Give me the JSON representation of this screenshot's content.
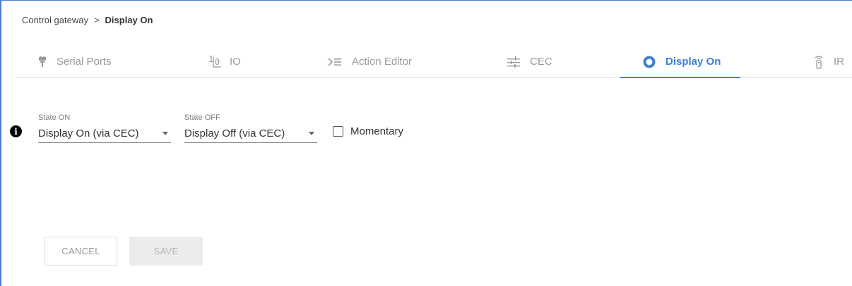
{
  "breadcrumb": {
    "parent": "Control gateway",
    "separator": ">",
    "current": "Display On"
  },
  "tabs": [
    {
      "label": "Serial Ports",
      "icon": "serial-port-icon"
    },
    {
      "label": "IO",
      "icon": "io-icon",
      "icon_text_top": "1",
      "icon_text_bottom": "0"
    },
    {
      "label": "Action Editor",
      "icon": "action-editor-icon"
    },
    {
      "label": "CEC",
      "icon": "cec-sliders-icon"
    },
    {
      "label": "Display On",
      "icon": "display-on-circle-icon",
      "active": true
    },
    {
      "label": "IR",
      "icon": "ir-remote-icon"
    }
  ],
  "form": {
    "state_on": {
      "label": "State ON",
      "value": "Display On (via CEC)"
    },
    "state_off": {
      "label": "State OFF",
      "value": "Display Off (via CEC)"
    },
    "momentary": {
      "label": "Momentary",
      "checked": false
    }
  },
  "info": {
    "icon": "info-icon",
    "glyph": "i"
  },
  "buttons": {
    "cancel": "CANCEL",
    "save": "SAVE"
  },
  "colors": {
    "accent": "#3f7fd4",
    "inactive_tab": "#9a9a9a"
  }
}
